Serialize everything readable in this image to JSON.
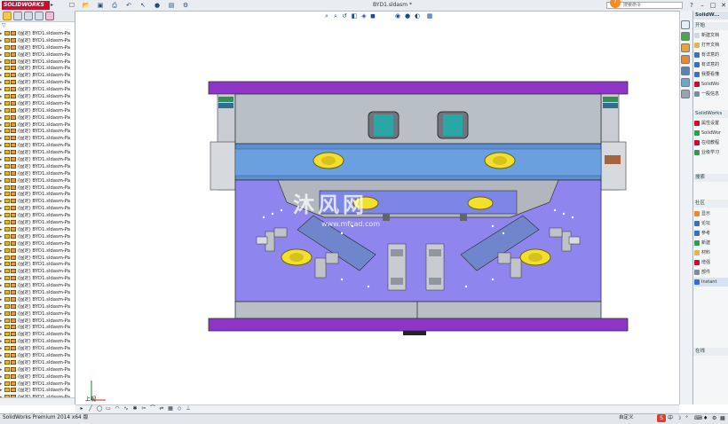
{
  "app": {
    "logo": "SOLIDWORKS",
    "document_title": "BYD1.sldasm *",
    "status_text": "SolidWorks Premium 2014 x64 版",
    "status_units": "自定义"
  },
  "search": {
    "placeholder": "搜索命令"
  },
  "help_badge": "?",
  "window_buttons": [
    "–",
    "□",
    "✕"
  ],
  "tree": {
    "item_label": "(固定) BYD1.sldasm-Pa",
    "item_count": 53
  },
  "view": {
    "label": "上视"
  },
  "right_panel": {
    "title": "SolidW...",
    "section_start": "开始",
    "start_items": [
      "新建文档",
      "打开文档",
      "有详意的",
      "有详意的",
      "我要看懂",
      "SolidWo",
      "一般信息"
    ],
    "section_resources": "SolidWorks",
    "resource_items": [
      "属性设置",
      "SolidWor",
      "在线教程",
      "业级学习"
    ],
    "section_search": "搜索",
    "section_community": "社区",
    "community_items": [
      "显示",
      "论坛",
      "参考",
      "新建",
      "材料",
      "增强",
      "部件",
      "Instant"
    ],
    "section_online": "在线"
  },
  "watermark": {
    "text": "沐风网",
    "url": "www.mfcad.com"
  },
  "colors": {
    "plate_purple": "#8e35c8",
    "plate_blue": "#5b8fd3",
    "plate_gray": "#b9bfc7",
    "cavity_violet": "#8e86ee",
    "cooling_teal": "#2aa6a6",
    "bolt_yellow": "#f2df2e"
  }
}
